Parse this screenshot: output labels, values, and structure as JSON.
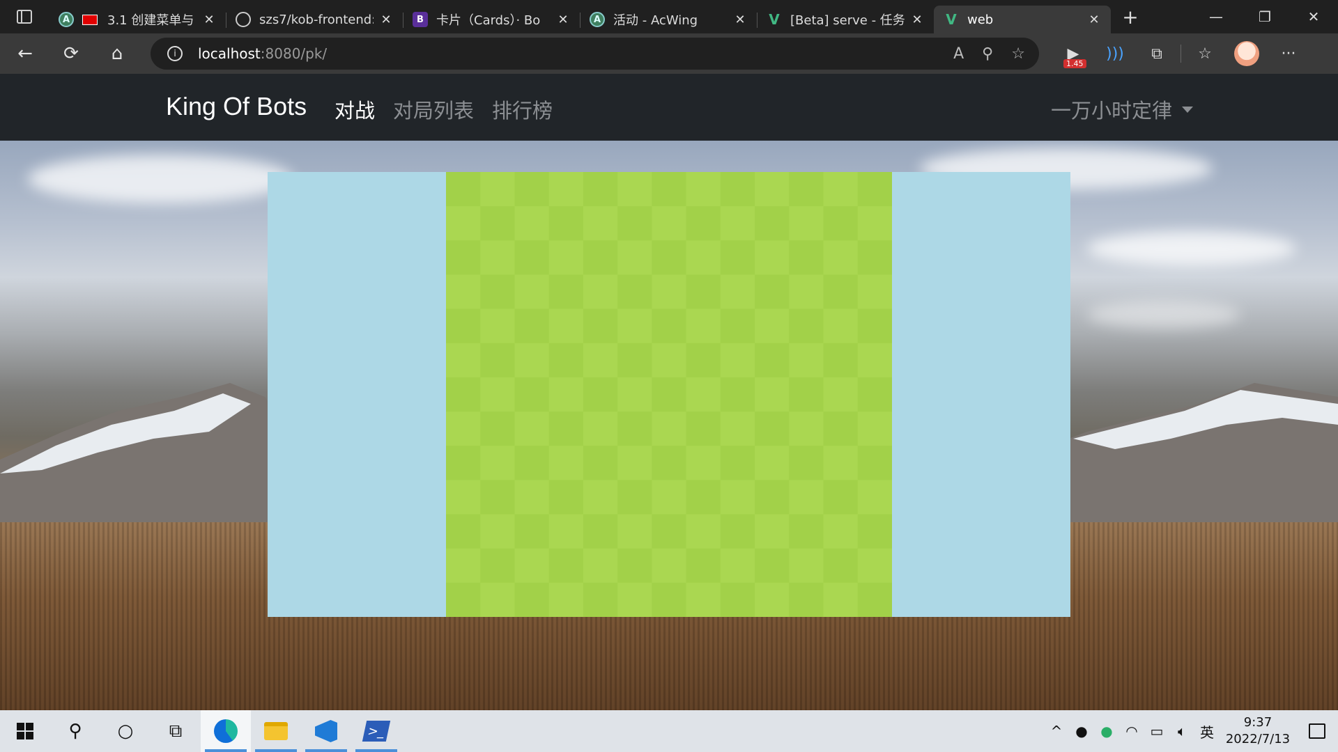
{
  "browser": {
    "tabs": [
      {
        "title": "3.1 创建菜单与",
        "favicon": "acwing-icon",
        "recording": true
      },
      {
        "title": "szs7/kob-frontend:",
        "favicon": "github-icon"
      },
      {
        "title": "卡片（Cards）· Bo",
        "favicon": "bootstrap-icon"
      },
      {
        "title": "活动 - AcWing",
        "favicon": "acwing-icon"
      },
      {
        "title": "[Beta] serve - 任务",
        "favicon": "vue-icon"
      },
      {
        "title": "web",
        "favicon": "vue-icon",
        "active": true
      }
    ],
    "address": {
      "host": "localhost",
      "path": ":8080/pk/"
    },
    "extension_badge": "1.45"
  },
  "app": {
    "brand": "King Of Bots",
    "nav": [
      {
        "label": "对战",
        "active": true
      },
      {
        "label": "对局列表"
      },
      {
        "label": "排行榜"
      }
    ],
    "user": "一万小时定律"
  },
  "game": {
    "rows": 13,
    "cols": 13,
    "background_color": "#add8e6",
    "cell_light": "#AAD751",
    "cell_dark": "#A2D149"
  },
  "taskbar": {
    "time": "9:37",
    "date": "2022/7/13",
    "ime": "英"
  }
}
